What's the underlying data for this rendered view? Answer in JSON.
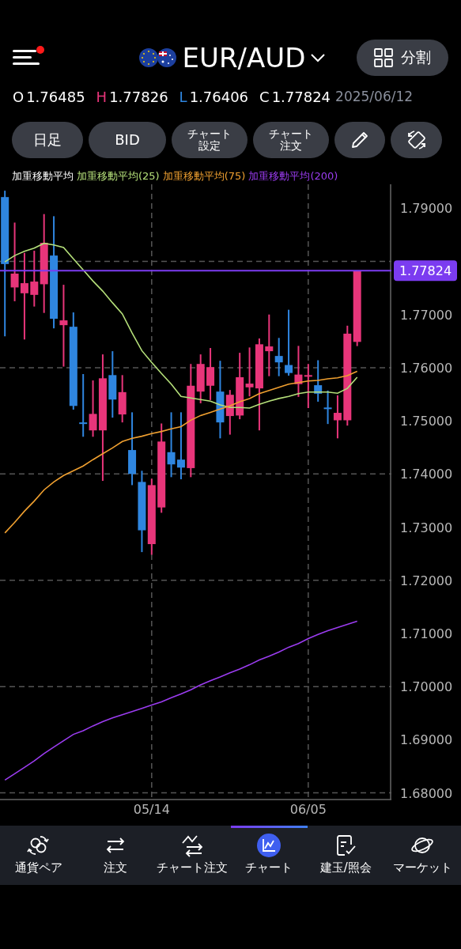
{
  "header": {
    "menu": {
      "badge": true
    },
    "pair": "EUR/AUD",
    "split_button": "分割"
  },
  "ohlc": [
    {
      "label": "O",
      "value": "1.76485",
      "color": "#ffffff"
    },
    {
      "label": "H",
      "value": "1.77826",
      "color": "#e8357a"
    },
    {
      "label": "L",
      "value": "1.76406",
      "color": "#2f86e0"
    },
    {
      "label": "C",
      "value": "1.77824",
      "color": "#ffffff"
    }
  ],
  "date": "2025/06/12",
  "toolbar": [
    {
      "kind": "text",
      "label": "日足"
    },
    {
      "kind": "text",
      "label": "BID"
    },
    {
      "kind": "text",
      "label": "チャート設定"
    },
    {
      "kind": "text",
      "label": "チャート注文"
    },
    {
      "kind": "pencil"
    },
    {
      "kind": "rotate"
    }
  ],
  "chart": {
    "chart_data": {
      "type": "candlestick",
      "title": "加重移動平均",
      "grid": true,
      "categories": [
        null,
        null,
        null,
        null,
        null,
        null,
        null,
        null,
        null,
        null,
        null,
        null,
        null,
        null,
        null,
        "05/14",
        null,
        null,
        null,
        null,
        null,
        null,
        null,
        null,
        null,
        null,
        null,
        null,
        null,
        null,
        null,
        "06/05",
        null,
        null,
        null,
        null,
        null,
        null,
        null,
        null
      ],
      "ylim": [
        1.67874,
        1.79451
      ],
      "ref_lines": [
        {
          "axis": "y",
          "value": 1.77824,
          "label": "1.77824",
          "color": "#7b3cf0"
        }
      ],
      "yticks": [
        {
          "value": 1.79,
          "label": "1.79000"
        },
        {
          "value": 1.77,
          "label": "1.77000"
        },
        {
          "value": 1.76,
          "label": "1.76000"
        },
        {
          "value": 1.75,
          "label": "1.75000"
        },
        {
          "value": 1.74,
          "label": "1.74000"
        },
        {
          "value": 1.73,
          "label": "1.73000"
        },
        {
          "value": 1.72,
          "label": "1.72000"
        },
        {
          "value": 1.71,
          "label": "1.71000"
        },
        {
          "value": 1.7,
          "label": "1.70000"
        },
        {
          "value": 1.69,
          "label": "1.69000"
        },
        {
          "value": 1.68,
          "label": "1.68000"
        }
      ],
      "ohlc": [
        [
          1.7921,
          1.7933,
          1.7659,
          1.7795
        ],
        [
          1.7751,
          1.7873,
          1.7725,
          1.7777
        ],
        [
          1.774,
          1.7816,
          1.7653,
          1.7759
        ],
        [
          1.7737,
          1.782,
          1.7715,
          1.7762
        ],
        [
          1.7757,
          1.7889,
          1.7703,
          1.7835
        ],
        [
          1.7811,
          1.7885,
          1.7674,
          1.7692
        ],
        [
          1.768,
          1.7756,
          1.7602,
          1.7689
        ],
        [
          1.7677,
          1.7704,
          1.7521,
          1.7528
        ],
        [
          1.7497,
          1.7588,
          1.747,
          1.7494
        ],
        [
          1.7482,
          1.7576,
          1.747,
          1.7513
        ],
        [
          1.7482,
          1.7625,
          1.7387,
          1.758
        ],
        [
          1.7586,
          1.7631,
          1.7506,
          1.754
        ],
        [
          1.7512,
          1.7586,
          1.7497,
          1.7554
        ],
        [
          1.7445,
          1.7516,
          1.7379,
          1.74
        ],
        [
          1.7385,
          1.7406,
          1.7253,
          1.7294
        ],
        [
          1.7268,
          1.7391,
          1.7248,
          1.7379
        ],
        [
          1.7337,
          1.7495,
          1.7327,
          1.7461
        ],
        [
          1.7441,
          1.7516,
          1.7394,
          1.7418
        ],
        [
          1.7427,
          1.7516,
          1.739,
          1.7412
        ],
        [
          1.7411,
          1.7607,
          1.7394,
          1.7566
        ],
        [
          1.7555,
          1.7625,
          1.7533,
          1.7607
        ],
        [
          1.7566,
          1.7637,
          1.7539,
          1.7601
        ],
        [
          1.7555,
          1.7613,
          1.7467,
          1.7497
        ],
        [
          1.7509,
          1.7558,
          1.7474,
          1.7549
        ],
        [
          1.751,
          1.7628,
          1.7503,
          1.7582
        ],
        [
          1.7563,
          1.7638,
          1.7546,
          1.757
        ],
        [
          1.7561,
          1.7655,
          1.7482,
          1.7644
        ],
        [
          1.7631,
          1.77,
          1.7584,
          1.764
        ],
        [
          1.7622,
          1.7656,
          1.7584,
          1.761
        ],
        [
          1.7605,
          1.7709,
          1.7585,
          1.759
        ],
        [
          1.7569,
          1.7641,
          1.7545,
          1.7587
        ],
        [
          1.7584,
          1.7607,
          1.7524,
          1.7586
        ],
        [
          1.7567,
          1.7614,
          1.7536,
          1.7551
        ],
        [
          1.7525,
          1.7557,
          1.7494,
          1.7523
        ],
        [
          1.7501,
          1.7548,
          1.7467,
          1.7515
        ],
        [
          1.7501,
          1.7679,
          1.7491,
          1.7664
        ],
        [
          1.76485,
          1.77826,
          1.76406,
          1.77824
        ],
        null,
        null,
        null
      ],
      "series": [
        {
          "name": "加重移動平均(25)",
          "type": "line",
          "color": "#b5e07a",
          "values": [
            1.7799,
            1.7811,
            1.7819,
            1.7825,
            1.7834,
            1.7831,
            1.7826,
            1.7805,
            1.7784,
            1.7763,
            1.7744,
            1.7722,
            1.7701,
            1.7665,
            1.7632,
            1.761,
            1.7589,
            1.7569,
            1.7546,
            1.7543,
            1.754,
            1.7537,
            1.753,
            1.7525,
            1.7525,
            1.7524,
            1.7531,
            1.7537,
            1.7542,
            1.7546,
            1.7551,
            1.7554,
            1.7554,
            1.7554,
            1.7552,
            1.7561,
            1.7582,
            null,
            null,
            null
          ]
        },
        {
          "name": "加重移動平均(75)",
          "type": "line",
          "color": "#f0a030",
          "values": [
            1.7289,
            1.7309,
            1.733,
            1.7349,
            1.737,
            1.7385,
            1.7397,
            1.7406,
            1.7415,
            1.7427,
            1.7438,
            1.7449,
            1.7461,
            1.7467,
            1.7471,
            1.7476,
            1.748,
            1.7485,
            1.7489,
            1.7501,
            1.751,
            1.7516,
            1.7522,
            1.7528,
            1.7536,
            1.7542,
            1.7551,
            1.7557,
            1.7563,
            1.7569,
            1.7572,
            1.7575,
            1.7576,
            1.7579,
            1.7581,
            1.7585,
            1.7593,
            null,
            null,
            null
          ]
        },
        {
          "name": "加重移動平均(200)",
          "type": "line",
          "color": "#9b3cf0",
          "values": [
            1.6824,
            1.6836,
            1.6848,
            1.686,
            1.6874,
            1.6886,
            1.6898,
            1.691,
            1.6917,
            1.6926,
            1.6934,
            1.6941,
            1.6947,
            1.6953,
            1.6959,
            1.6965,
            1.6971,
            1.6979,
            1.6986,
            1.6994,
            1.7003,
            1.7011,
            1.7018,
            1.7026,
            1.7033,
            1.7041,
            1.705,
            1.7057,
            1.7065,
            1.7074,
            1.7081,
            1.709,
            1.7098,
            1.7105,
            1.7111,
            1.7117,
            1.7123,
            null,
            null,
            null
          ]
        }
      ]
    }
  },
  "nav": [
    {
      "label": "通貨ペア",
      "selected": false
    },
    {
      "label": "注文",
      "selected": false
    },
    {
      "label": "チャート注文",
      "selected": false
    },
    {
      "label": "チャート",
      "selected": true
    },
    {
      "label": "建玉/照会",
      "selected": false
    },
    {
      "label": "マーケット",
      "selected": false
    }
  ]
}
